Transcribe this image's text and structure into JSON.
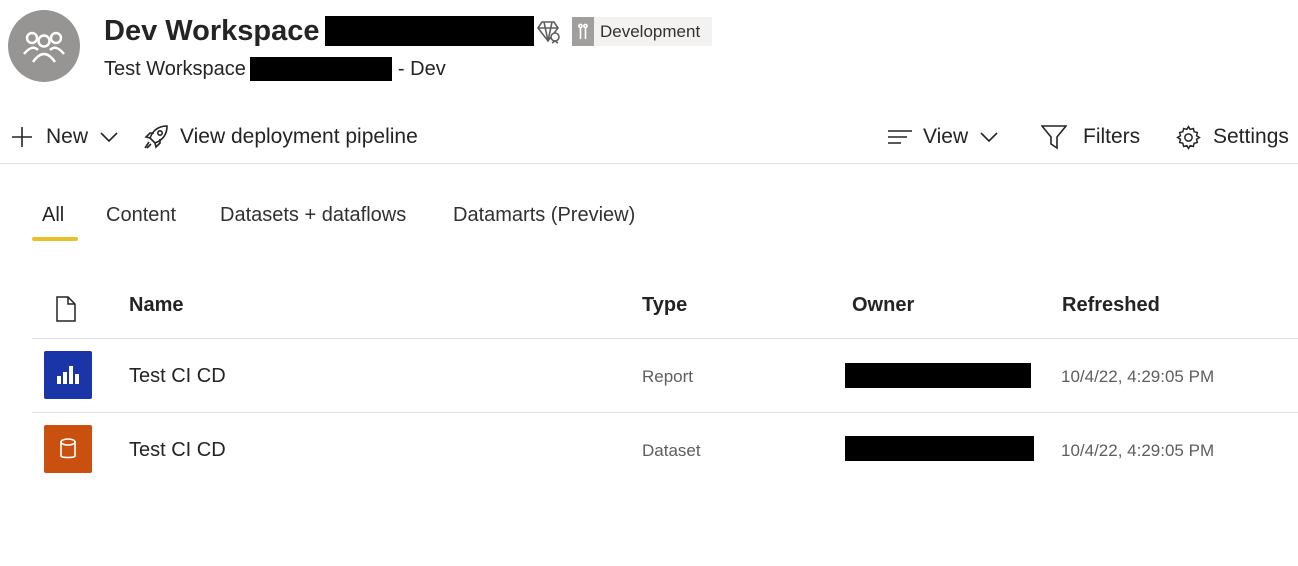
{
  "workspace": {
    "title": "Dev Workspace",
    "subtitle_prefix": "Test Workspace",
    "subtitle_suffix": "- Dev",
    "environment_label": "Development",
    "avatar_icon": "people-group-icon",
    "premium_icon": "premium-diamond-icon"
  },
  "toolbar": {
    "new_label": "New",
    "pipeline_label": "View deployment pipeline",
    "view_label": "View",
    "filters_label": "Filters",
    "settings_label": "Settings"
  },
  "tabs": [
    {
      "label": "All",
      "active": true
    },
    {
      "label": "Content",
      "active": false
    },
    {
      "label": "Datasets + dataflows",
      "active": false
    },
    {
      "label": "Datamarts (Preview)",
      "active": false
    }
  ],
  "table": {
    "columns": {
      "name": "Name",
      "type": "Type",
      "owner": "Owner",
      "refreshed": "Refreshed"
    },
    "rows": [
      {
        "name": "Test CI CD",
        "type": "Report",
        "refreshed": "10/4/22, 4:29:05 PM",
        "icon": "report-bar-chart-icon",
        "icon_color": "#1a35a8"
      },
      {
        "name": "Test CI CD",
        "type": "Dataset",
        "refreshed": "10/4/22, 4:29:05 PM",
        "icon": "dataset-cylinder-icon",
        "icon_color": "#ca5010"
      }
    ]
  },
  "colors": {
    "tab_underline": "#e8c127",
    "avatar_bg": "#979593",
    "report_icon_bg": "#1a35a8",
    "dataset_icon_bg": "#ca5010"
  }
}
